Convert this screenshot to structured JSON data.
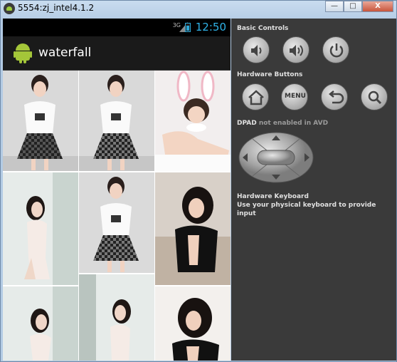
{
  "window": {
    "title": "5554:zj_intel4.1.2",
    "buttons": {
      "minimize": "—",
      "maximize": "□",
      "close": "X"
    }
  },
  "statusbar": {
    "signal": "3G",
    "time": "12:50"
  },
  "app": {
    "title": "waterfall"
  },
  "gallery": {
    "columns": [
      [
        "model-white-top-checked-skirt",
        "model-lingerie-window",
        "model-lingerie-window"
      ],
      [
        "model-white-top-checked-skirt",
        "model-white-top-checked-skirt",
        "model-lingerie-window"
      ],
      [
        "model-bunny-ears-lying",
        "model-black-top-sofa",
        "model-black-top-sofa"
      ]
    ]
  },
  "controls": {
    "basic_title": "Basic Controls",
    "basic": [
      "volume-down-icon",
      "volume-up-icon",
      "power-icon"
    ],
    "hardware_title": "Hardware Buttons",
    "hardware": [
      "home-icon",
      "menu-button",
      "back-icon",
      "search-icon"
    ],
    "menu_label": "MENU",
    "dpad_title": "DPAD",
    "dpad_note": "not enabled in AVD",
    "keyboard_title": "Hardware Keyboard",
    "keyboard_note": "Use your physical keyboard to provide input"
  },
  "colors": {
    "clock": "#2fb3e8",
    "android_green": "#a4c639",
    "panel": "#3a3a3a"
  }
}
